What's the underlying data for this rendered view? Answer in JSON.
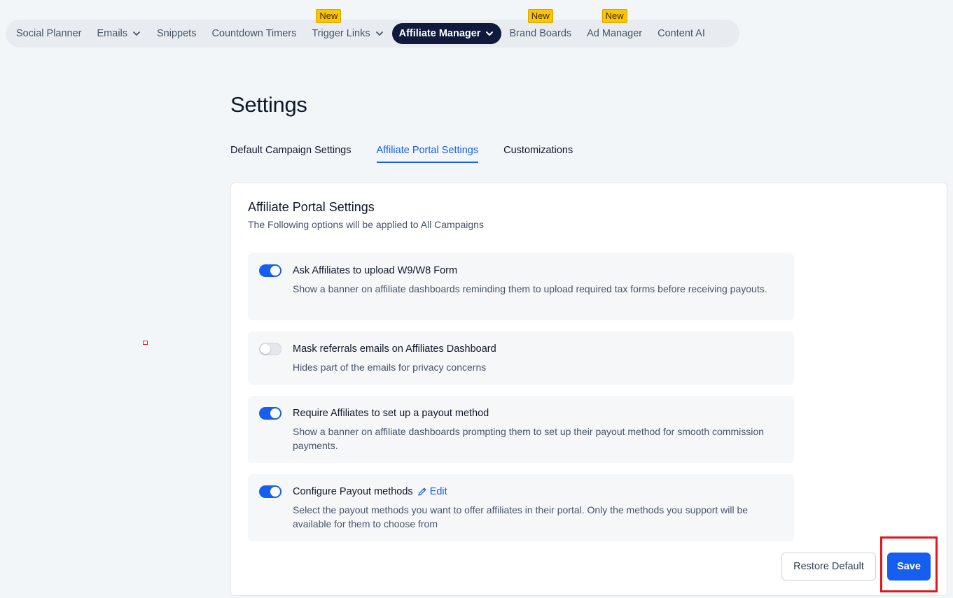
{
  "nav": {
    "items": [
      {
        "label": "Social Planner"
      },
      {
        "label": "Emails"
      },
      {
        "label": "Snippets"
      },
      {
        "label": "Countdown Timers"
      },
      {
        "label": "Trigger Links",
        "badge": "New"
      },
      {
        "label": "Affiliate Manager"
      },
      {
        "label": "Brand Boards",
        "badge": "New"
      },
      {
        "label": "Ad Manager",
        "badge": "New"
      },
      {
        "label": "Content AI"
      }
    ],
    "active": "Affiliate Manager"
  },
  "page": {
    "title": "Settings"
  },
  "tabs": [
    {
      "label": "Default Campaign Settings"
    },
    {
      "label": "Affiliate Portal Settings"
    },
    {
      "label": "Customizations"
    }
  ],
  "active_tab": "Affiliate Portal Settings",
  "card": {
    "title": "Affiliate Portal Settings",
    "subtitle": "The Following options will be applied to All Campaigns",
    "options": [
      {
        "title": "Ask Affiliates to upload W9/W8 Form",
        "description": "Show a banner on affiliate dashboards reminding them to upload required tax forms before receiving payouts.",
        "enabled": true
      },
      {
        "title": "Mask referrals emails on Affiliates Dashboard",
        "description": "Hides part of the emails for privacy concerns",
        "enabled": false
      },
      {
        "title": "Require Affiliates to set up a payout method",
        "description": "Show a banner on affiliate dashboards prompting them to set up their payout method for smooth commission payments.",
        "enabled": true
      },
      {
        "title": "Configure Payout methods",
        "edit_label": "Edit",
        "description": "Select the payout methods you want to offer affiliates in their portal. Only the methods you support will be available for them to choose from",
        "enabled": true
      }
    ],
    "restore_label": "Restore Default",
    "save_label": "Save"
  },
  "colors": {
    "accent": "#155eef",
    "nav_active_bg": "#101a3c",
    "badge": "#fdc500",
    "highlight": "#e3161b"
  }
}
